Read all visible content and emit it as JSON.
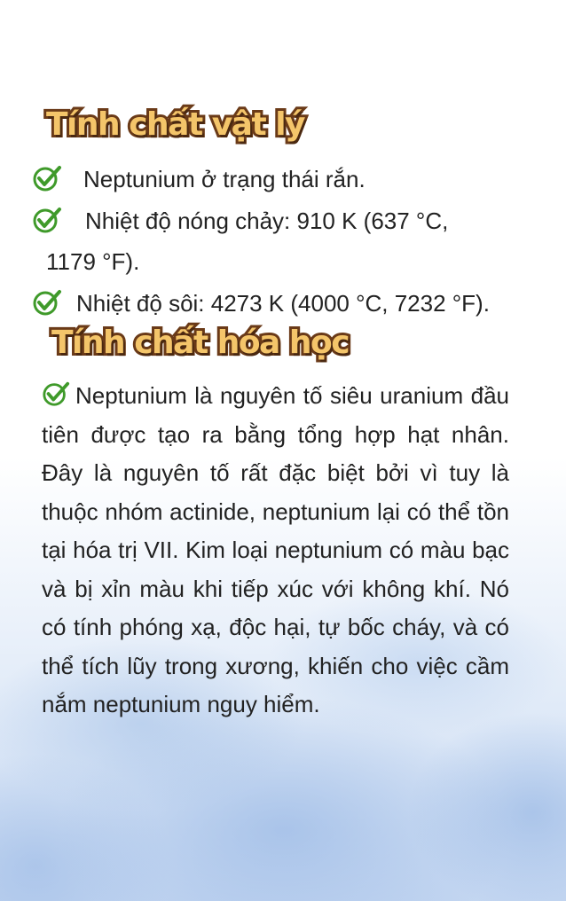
{
  "section_physical": {
    "title": "Tính chất vật lý",
    "items": [
      "Neptunium ở trạng thái rắn.",
      "Nhiệt độ nóng chảy: 910 K (637 °C,",
      "1179 °F).",
      "Nhiệt độ sôi: 4273 K (4000 °C, 7232 °F)."
    ]
  },
  "section_chemical": {
    "title": "Tính chất hóa học",
    "paragraph": "Neptunium là nguyên tố siêu uranium đầu tiên được tạo ra bằng tổng hợp hạt nhân. Đây là nguyên tố rất đặc biệt bởi vì tuy là thuộc nhóm actinide, neptunium lại có thể tồn tại hóa trị VII. Kim loại neptunium có màu bạc và bị xỉn màu khi tiếp xúc với không khí. Nó có tính phóng xạ, độc hại, tự bốc cháy, và có thể tích lũy trong xương, khiến cho việc cầm nắm neptunium nguy hiểm."
  },
  "icons": {
    "bullet": "check-circle-icon"
  },
  "colors": {
    "check": "#3f9a2a",
    "heading_fill": "#f4c56a",
    "heading_outline": "#6a3a18"
  }
}
